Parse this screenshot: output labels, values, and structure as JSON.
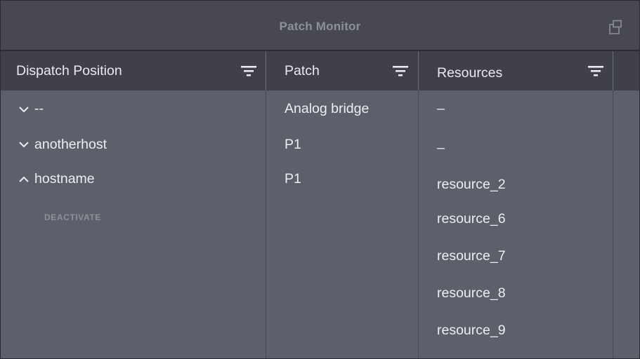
{
  "window": {
    "title": "Patch Monitor",
    "popout_icon": "popout-window-icon"
  },
  "columns": [
    {
      "label": "Dispatch Position",
      "icon": "filter-icon"
    },
    {
      "label": "Patch",
      "icon": "filter-icon"
    },
    {
      "label": "Resources",
      "icon": "filter-icon"
    }
  ],
  "positions": [
    {
      "name": "--",
      "expander": "chevron-down-icon"
    },
    {
      "name": "anotherhost",
      "expander": "chevron-down-icon"
    },
    {
      "name": "hostname",
      "expander": "chevron-up-icon",
      "action": "DEACTIVATE"
    }
  ],
  "patches": [
    "Analog bridge",
    "P1",
    "P1"
  ],
  "resources": [
    "–",
    "–",
    "resource_2",
    "resource_6",
    "resource_7",
    "resource_8",
    "resource_9"
  ],
  "colors": {
    "titlebar": "#474851",
    "header": "#3f4049",
    "body": "#5d5f6a",
    "text": "#eceef2",
    "muted": "#8e9099"
  }
}
